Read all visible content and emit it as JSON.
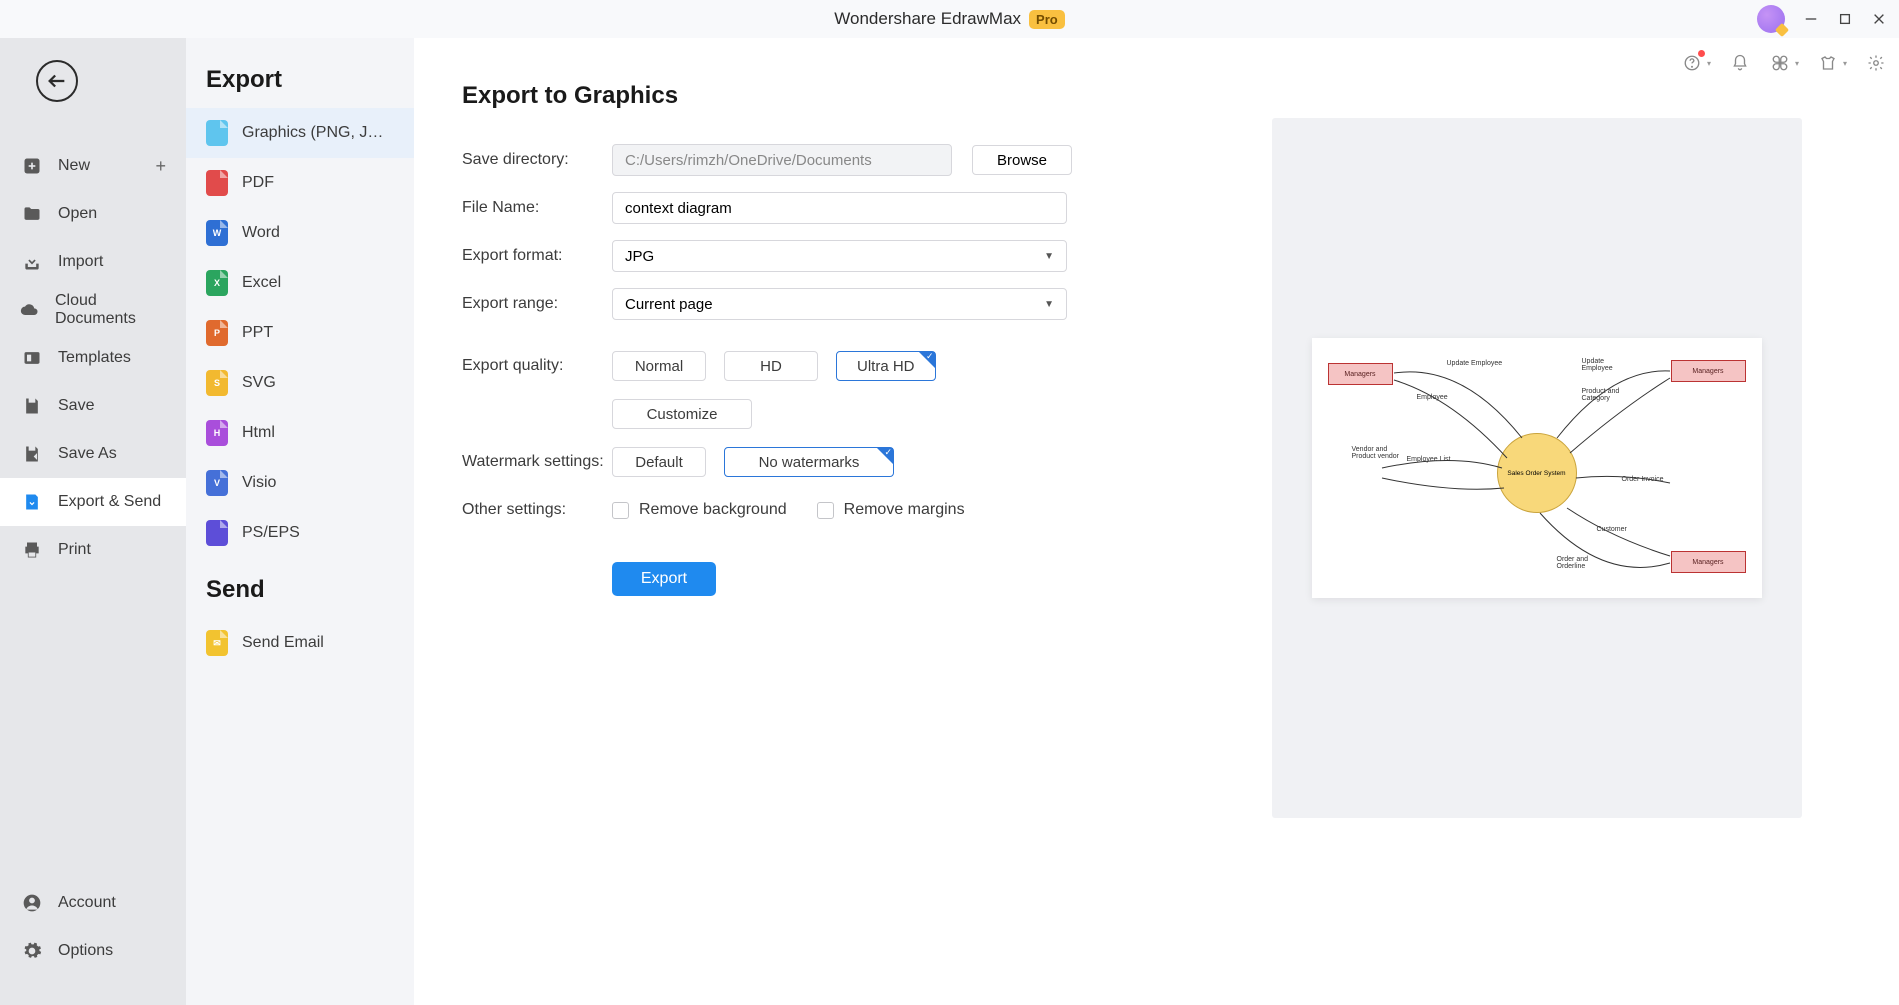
{
  "title": {
    "app": "Wondershare EdrawMax",
    "pro": "Pro"
  },
  "sidebar1": {
    "new": "New",
    "open": "Open",
    "import": "Import",
    "cloud": "Cloud Documents",
    "templates": "Templates",
    "save": "Save",
    "saveas": "Save As",
    "export_send": "Export & Send",
    "print": "Print",
    "account": "Account",
    "options": "Options"
  },
  "sidebar2": {
    "export_heading": "Export",
    "graphics": "Graphics (PNG, JPG et...",
    "pdf": "PDF",
    "word": "Word",
    "excel": "Excel",
    "ppt": "PPT",
    "svg": "SVG",
    "html": "Html",
    "visio": "Visio",
    "pseps": "PS/EPS",
    "send_heading": "Send",
    "send_email": "Send Email"
  },
  "form": {
    "heading": "Export to Graphics",
    "labels": {
      "save_dir": "Save directory:",
      "file_name": "File Name:",
      "export_format": "Export format:",
      "export_range": "Export range:",
      "export_quality": "Export quality:",
      "watermark": "Watermark settings:",
      "other": "Other settings:"
    },
    "values": {
      "save_dir": "C:/Users/rimzh/OneDrive/Documents",
      "file_name": "context diagram",
      "format": "JPG",
      "range": "Current page"
    },
    "quality_opts": {
      "normal": "Normal",
      "hd": "HD",
      "ultra": "Ultra HD",
      "custom": "Customize"
    },
    "watermark_opts": {
      "default": "Default",
      "none": "No watermarks"
    },
    "other_opts": {
      "remove_bg": "Remove background",
      "remove_margins": "Remove margins"
    },
    "browse": "Browse",
    "export": "Export"
  },
  "preview": {
    "center": "Sales Order System",
    "top_left": "Managers",
    "top_right": "Managers",
    "bottom_right": "Managers",
    "edge_labels": [
      "Update Employee",
      "Employee",
      "Vendor and Product vendor",
      "Employee List",
      "Update Employee",
      "Product and Category",
      "Order Invoice",
      "Customer",
      "Order and Orderline"
    ]
  }
}
